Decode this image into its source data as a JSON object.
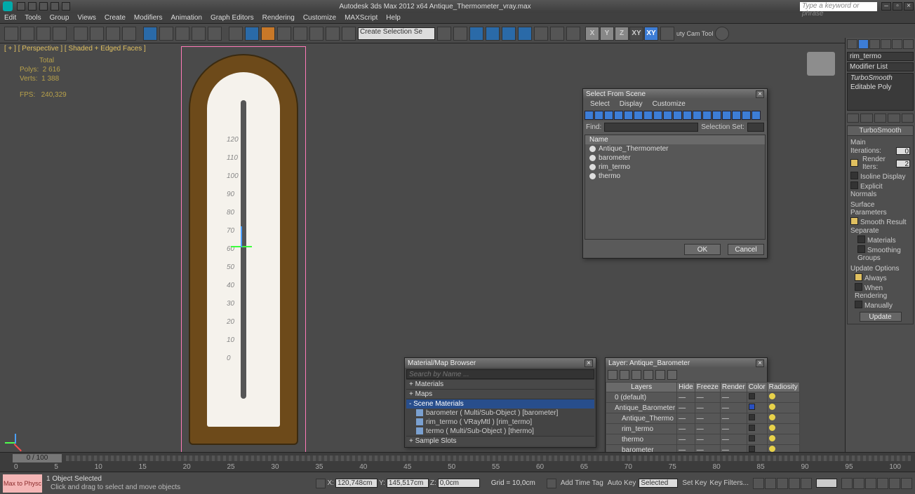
{
  "app": {
    "title": "Autodesk 3ds Max  2012 x64     Antique_Thermometer_vray.max",
    "search_placeholder": "Type a keyword or phrase"
  },
  "menu": [
    "Edit",
    "Tools",
    "Group",
    "Views",
    "Create",
    "Modifiers",
    "Animation",
    "Graph Editors",
    "Rendering",
    "Customize",
    "MAXScript",
    "Help"
  ],
  "toolbar": {
    "selset_label": "Create Selection Se",
    "xyz": [
      "X",
      "Y",
      "Z",
      "XY",
      "XY"
    ],
    "camtool": "uty Cam Tool"
  },
  "viewport": {
    "label": "[ + ] [ Perspective ] [ Shaded + Edged Faces ]",
    "stats": {
      "hdr": "Total",
      "polys_l": "Polys:",
      "polys_v": "2 616",
      "verts_l": "Verts:",
      "verts_v": "1 388",
      "fps_l": "FPS:",
      "fps_v": "240,329"
    },
    "scale": [
      "120",
      "110",
      "100",
      "90",
      "80",
      "70",
      "60",
      "50",
      "40",
      "30",
      "20",
      "10",
      "0"
    ]
  },
  "select_from_scene": {
    "title": "Select From Scene",
    "tabs": [
      "Select",
      "Display",
      "Customize"
    ],
    "find_label": "Find:",
    "selset_label": "Selection Set:",
    "listhdr": "Name",
    "items": [
      "Antique_Thermometer",
      "barometer",
      "rim_termo",
      "thermo"
    ],
    "ok": "OK",
    "cancel": "Cancel"
  },
  "material_browser": {
    "title": "Material/Map Browser",
    "search_placeholder": "Search by Name ...",
    "sections": {
      "materials": "+ Materials",
      "maps": "+ Maps",
      "scene": "- Scene Materials",
      "samples": "+ Sample Slots"
    },
    "scene_items": [
      "barometer  ( Multi/Sub-Object )  [barometer]",
      "rim_termo  ( VRayMtl )  [rim_termo]",
      "termo  ( Multi/Sub-Object )  [thermo]"
    ]
  },
  "layers": {
    "title": "Layer: Antique_Barometer",
    "headers": [
      "Layers",
      "Hide",
      "Freeze",
      "Render",
      "Color",
      "Radiosity"
    ],
    "rows": [
      "0 (default)",
      "Antique_Barometer",
      "Antique_Thermo",
      "rim_termo",
      "thermo",
      "barometer"
    ]
  },
  "cmdpanel": {
    "objname": "rim_termo",
    "modlist_label": "Modifier List",
    "stack": [
      "TurboSmooth",
      "Editable Poly"
    ],
    "ts": {
      "header": "TurboSmooth",
      "main": "Main",
      "iter_l": "Iterations:",
      "iter_v": "0",
      "render_l": "Render Iters:",
      "render_v": "2",
      "isoline": "Isoline Display",
      "explicit": "Explicit Normals",
      "surf_hdr": "Surface Parameters",
      "smoothres": "Smooth Result",
      "separate": "Separate",
      "mats": "Materials",
      "sg": "Smoothing Groups",
      "upd_hdr": "Update Options",
      "always": "Always",
      "whenrend": "When Rendering",
      "manually": "Manually",
      "updbtn": "Update"
    }
  },
  "timeline": {
    "slider_text": "0 / 100",
    "ticks": [
      "0",
      "5",
      "10",
      "15",
      "20",
      "25",
      "30",
      "35",
      "40",
      "45",
      "50",
      "55",
      "60",
      "65",
      "70",
      "75",
      "80",
      "85",
      "90",
      "95",
      "100"
    ]
  },
  "status": {
    "maxscript": "Max to Physc",
    "selected": "1 Object Selected",
    "prompt": "Click and drag to select and move objects",
    "x_l": "X:",
    "x_v": "120,748cm",
    "y_l": "Y:",
    "y_v": "145,517cm",
    "z_l": "Z:",
    "z_v": "0,0cm",
    "grid": "Grid = 10,0cm",
    "addtag": "Add Time Tag",
    "autokey": "Auto Key",
    "setkey": "Set Key",
    "keyfilters": "Key Filters...",
    "selmode": "Selected",
    "curframe": "0"
  }
}
